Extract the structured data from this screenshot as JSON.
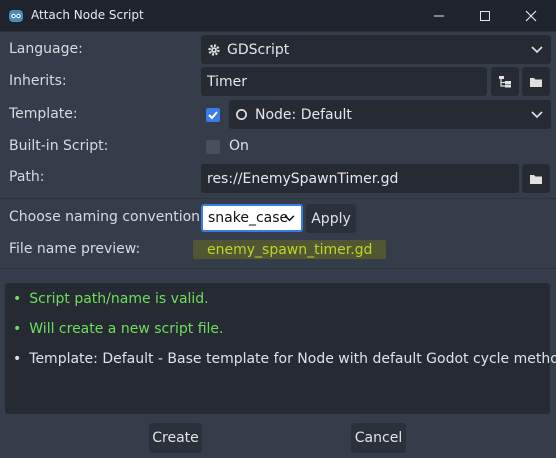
{
  "window": {
    "title": "Attach Node Script"
  },
  "colors": {
    "accent": "#3a7be8",
    "success": "#6ddd5e",
    "highlight_bg": "#525733",
    "highlight_fg": "#c2d227"
  },
  "form": {
    "language": {
      "label": "Language:",
      "value": "GDScript",
      "icon": "gdscript-gear-icon"
    },
    "inherits": {
      "label": "Inherits:",
      "value": "Timer",
      "tree_icon": "class-tree-icon",
      "browse_icon": "folder-icon"
    },
    "template": {
      "label": "Template:",
      "checked": true,
      "value": "Node: Default",
      "icon": "circle-node-icon"
    },
    "builtin": {
      "label": "Built-in Script:",
      "checked": false,
      "state_label": "On"
    },
    "path": {
      "label": "Path:",
      "value": "res://EnemySpawnTimer.gd",
      "browse_icon": "folder-icon"
    },
    "naming": {
      "label": "Choose naming convention:",
      "selected": "snake_case",
      "apply_label": "Apply"
    },
    "preview": {
      "label": "File name preview:",
      "value": "enemy_spawn_timer.gd"
    }
  },
  "messages": [
    {
      "bullet": "•",
      "text": "Script path/name is valid.",
      "status": "success"
    },
    {
      "bullet": "•",
      "text": "Will create a new script file.",
      "status": "success"
    },
    {
      "bullet": "•",
      "text": "Template: Default - Base template for Node with default Godot cycle methods",
      "status": "info"
    }
  ],
  "buttons": {
    "create": "Create",
    "cancel": "Cancel"
  }
}
